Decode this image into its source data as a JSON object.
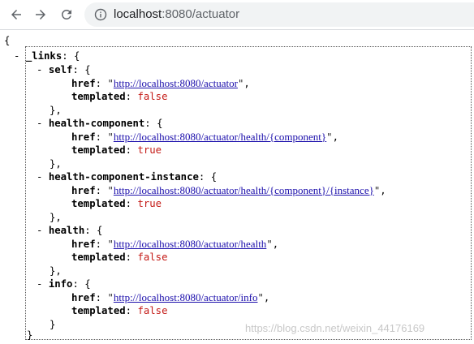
{
  "browser": {
    "url_host": "localhost",
    "url_rest": ":8080/actuator",
    "icons": [
      "back-arrow-icon",
      "forward-arrow-icon",
      "reload-icon",
      "info-icon"
    ]
  },
  "json": {
    "open_brace": "{",
    "close_brace": "}",
    "root_key": "_links",
    "entries": [
      {
        "name": "self",
        "href": "http://localhost:8080/actuator",
        "templated": "false"
      },
      {
        "name": "health-component",
        "href": "http://localhost:8080/actuator/health/{component}",
        "templated": "true"
      },
      {
        "name": "health-component-instance",
        "href": "http://localhost:8080/actuator/health/{component}/{instance}",
        "templated": "true"
      },
      {
        "name": "health",
        "href": "http://localhost:8080/actuator/health",
        "templated": "false"
      },
      {
        "name": "info",
        "href": "http://localhost:8080/actuator/info",
        "templated": "false"
      }
    ],
    "href_key": "href",
    "templated_key": "templated"
  },
  "watermark": "https://blog.csdn.net/weixin_44176169"
}
